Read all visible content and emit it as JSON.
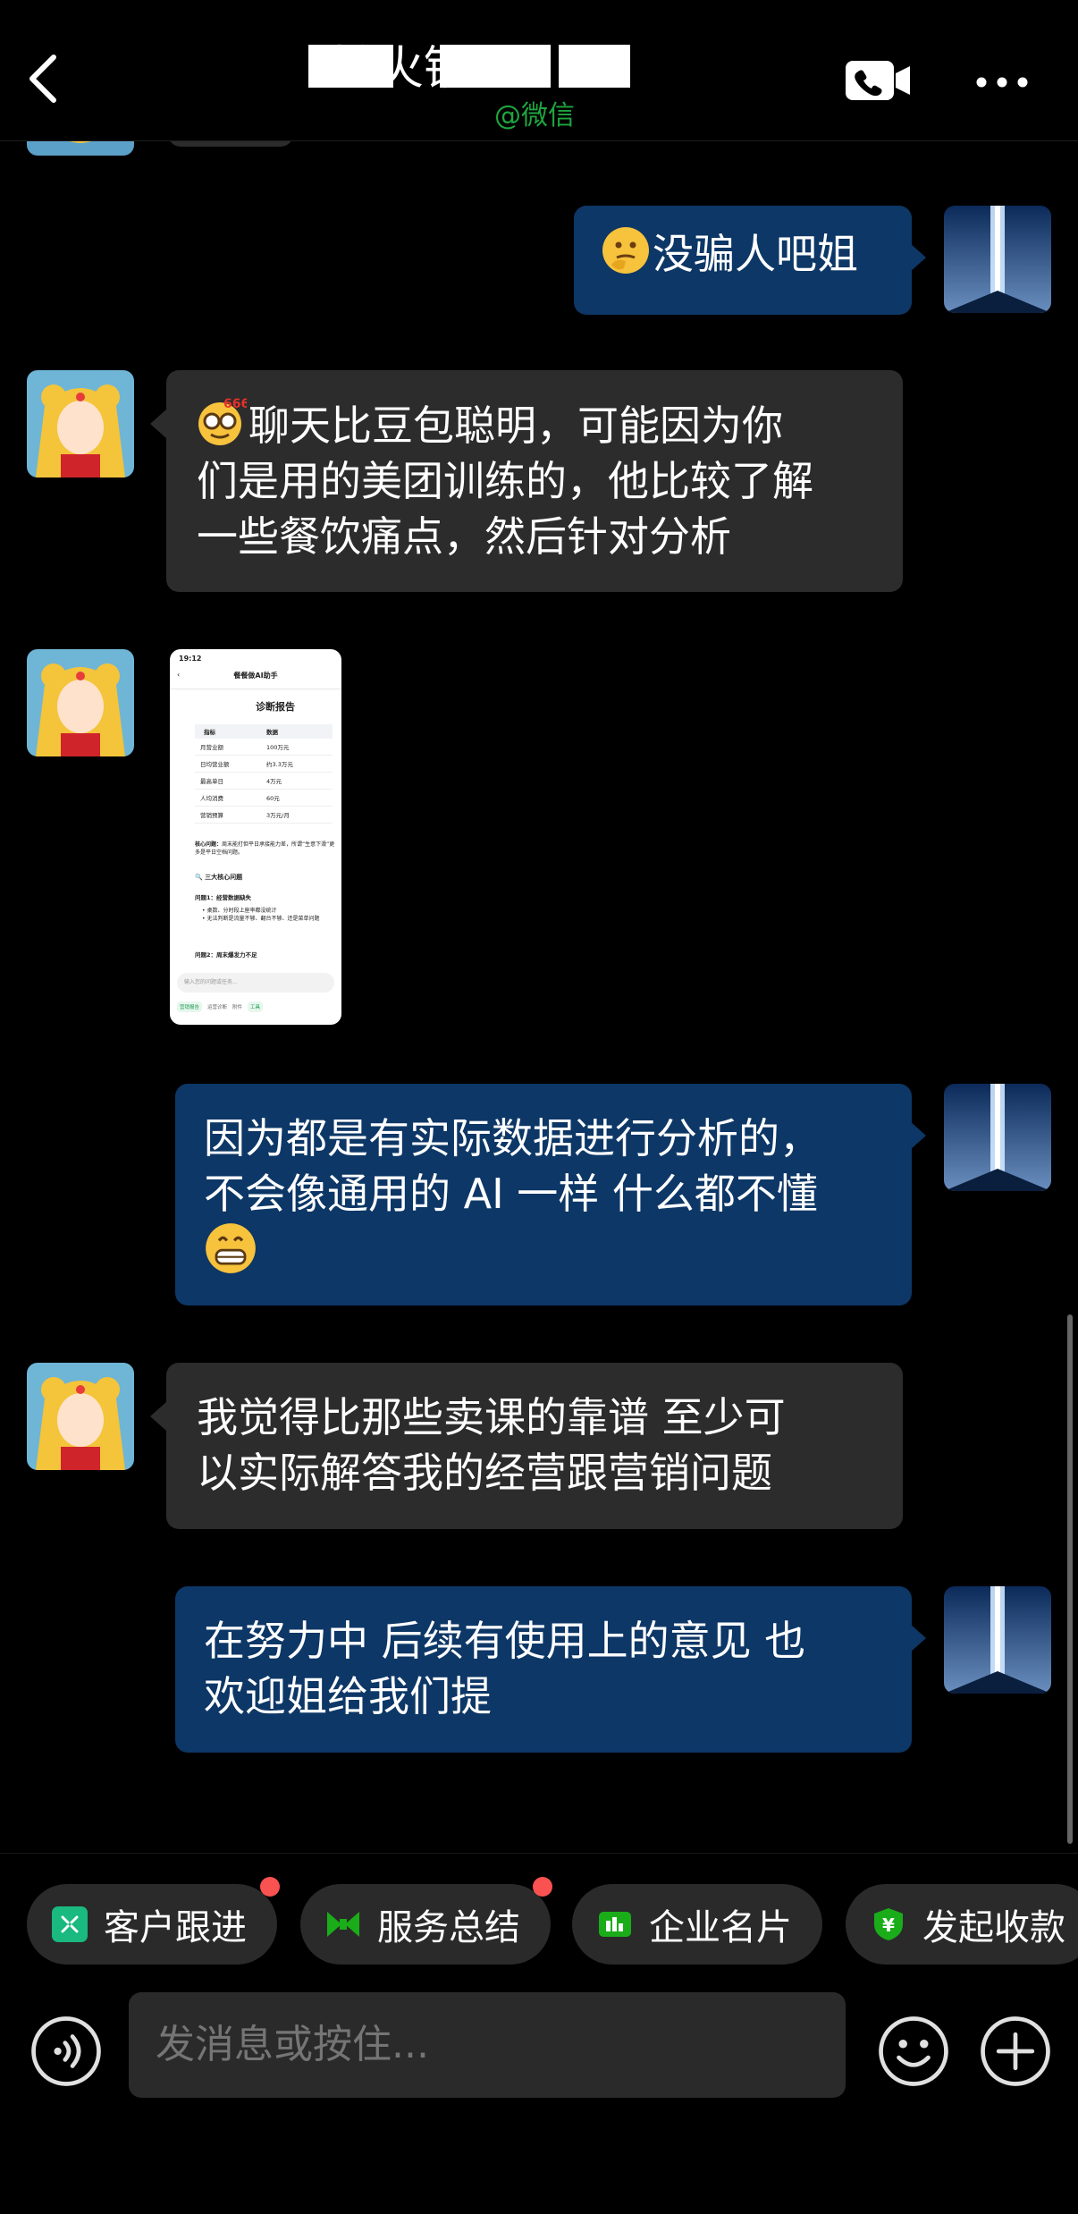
{
  "header": {
    "title": "摊火锅",
    "watermark": "@微信"
  },
  "messages": [
    {
      "id": "m1",
      "side": "out",
      "emoji": "thinking-face",
      "text": "没骗人吧姐"
    },
    {
      "id": "m2",
      "side": "in",
      "emoji": "nerd-face-666",
      "lines": [
        "聊天比豆包聪明，可能因为你",
        "们是用的美团训练的，他比较了解",
        "一些餐饮痛点，然后针对分析"
      ]
    },
    {
      "id": "m3",
      "side": "in",
      "type": "image"
    },
    {
      "id": "m4",
      "side": "out",
      "lines": [
        "因为都是有实际数据进行分析的，",
        "不会像通用的 AI 一样 什么都不懂"
      ],
      "emoji_after": "grinning-face"
    },
    {
      "id": "m5",
      "side": "in",
      "lines": [
        "我觉得比那些卖课的靠谱 至少可",
        "以实际解答我的经营跟营销问题"
      ]
    },
    {
      "id": "m6",
      "side": "out",
      "lines": [
        "在努力中 后续有使用上的意见 也",
        "欢迎姐给我们提"
      ]
    }
  ],
  "screenshot": {
    "time": "19:12",
    "app_title": "餐餐做AI助手",
    "heading": "诊断报告",
    "table_headers": [
      "指标",
      "数据"
    ],
    "table_rows": [
      [
        "月营业额",
        "100万元"
      ],
      [
        "日均营业额",
        "约3.3万元"
      ],
      [
        "最高单日",
        "4万元"
      ],
      [
        "人均消费",
        "60元"
      ],
      [
        "营销预算",
        "3万元/月"
      ]
    ],
    "core_issue_label": "核心问题：",
    "core_issue_text": "周末能打但平日承接能力差，所谓“生意下滑”更多是平日空档问题。",
    "section": "三大核心问题",
    "issue1": "问题1：经营数据缺失",
    "bullets": [
      "桌数、分时段上座率都没统计",
      "无法判断是流量不够、翻台不够、还是菜单问题"
    ],
    "issue2": "问题2：周末爆发力不足",
    "input_placeholder": "输入您的问题或任务...",
    "chips": [
      "营销报告",
      "运营诊断",
      "附件",
      "工具"
    ]
  },
  "shortcuts": [
    {
      "label": "客户跟进",
      "icon": "customer-followup-icon",
      "color": "#19b97f",
      "badge": true
    },
    {
      "label": "服务总结",
      "icon": "service-summary-icon",
      "color": "#1aad19",
      "badge": true
    },
    {
      "label": "企业名片",
      "icon": "business-card-icon",
      "color": "#1aad19",
      "badge": false
    },
    {
      "label": "发起收款",
      "icon": "payment-icon",
      "color": "#1aad19",
      "badge": false
    }
  ],
  "input": {
    "placeholder": "发消息或按住..."
  },
  "colors": {
    "outgoing_bubble": "#0d3766",
    "incoming_bubble": "#2c2c2c",
    "wechat_green": "#1fa53f",
    "badge_red": "#fa5151"
  }
}
